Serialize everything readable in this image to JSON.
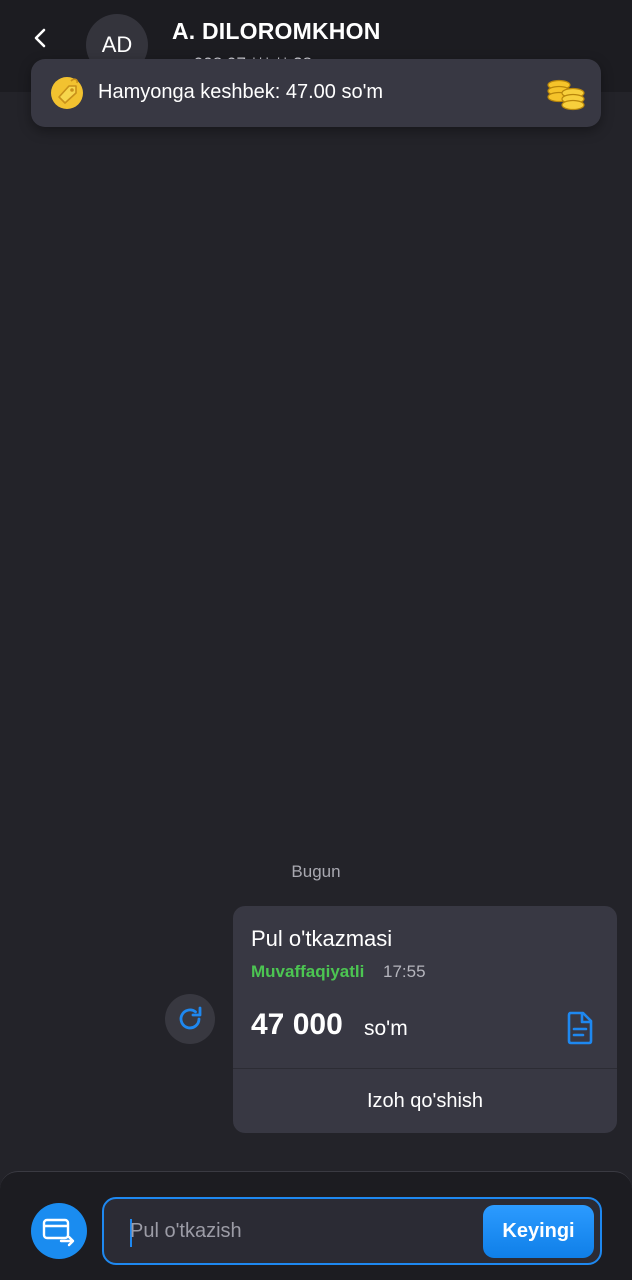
{
  "header": {
    "avatar_initials": "AD",
    "contact_name": "A. DILOROMKHON",
    "contact_phone": "+998 97 *** ** 38"
  },
  "cashback": {
    "text": "Hamyonga keshbek: 47.00 so'm"
  },
  "chat": {
    "day_label": "Bugun",
    "transfer": {
      "title": "Pul o'tkazmasi",
      "status": "Muvaffaqiyatli",
      "time": "17:55",
      "amount": "47 000",
      "currency": "so'm",
      "comment_label": "Izoh qo'shish"
    }
  },
  "composer": {
    "placeholder": "Pul o'tkazish",
    "next_label": "Keyingi"
  },
  "colors": {
    "background": "#232329",
    "card": "#383843",
    "accent": "#1e88f0",
    "success": "#4cc552"
  }
}
